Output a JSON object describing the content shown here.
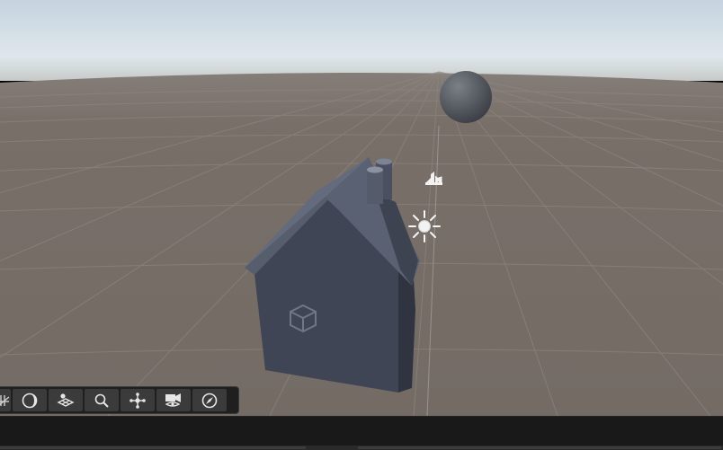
{
  "scene": {
    "sky_top": "#c5d5e0",
    "sky_horizon": "#e6ecef",
    "ground": "#776e68",
    "house_color": "#4a5263",
    "sphere_color": "#5a5e66",
    "objects": [
      "house",
      "sphere",
      "directional-light",
      "audio-source"
    ]
  },
  "overlay_toolbar": {
    "tools": [
      {
        "name": "grid-snap-icon"
      },
      {
        "name": "lighting-icon"
      },
      {
        "name": "layers-icon"
      },
      {
        "name": "search-icon"
      },
      {
        "name": "move-gizmo-icon"
      },
      {
        "name": "camera-icon"
      },
      {
        "name": "compass-icon"
      }
    ]
  },
  "status_bar": {
    "text": ""
  }
}
